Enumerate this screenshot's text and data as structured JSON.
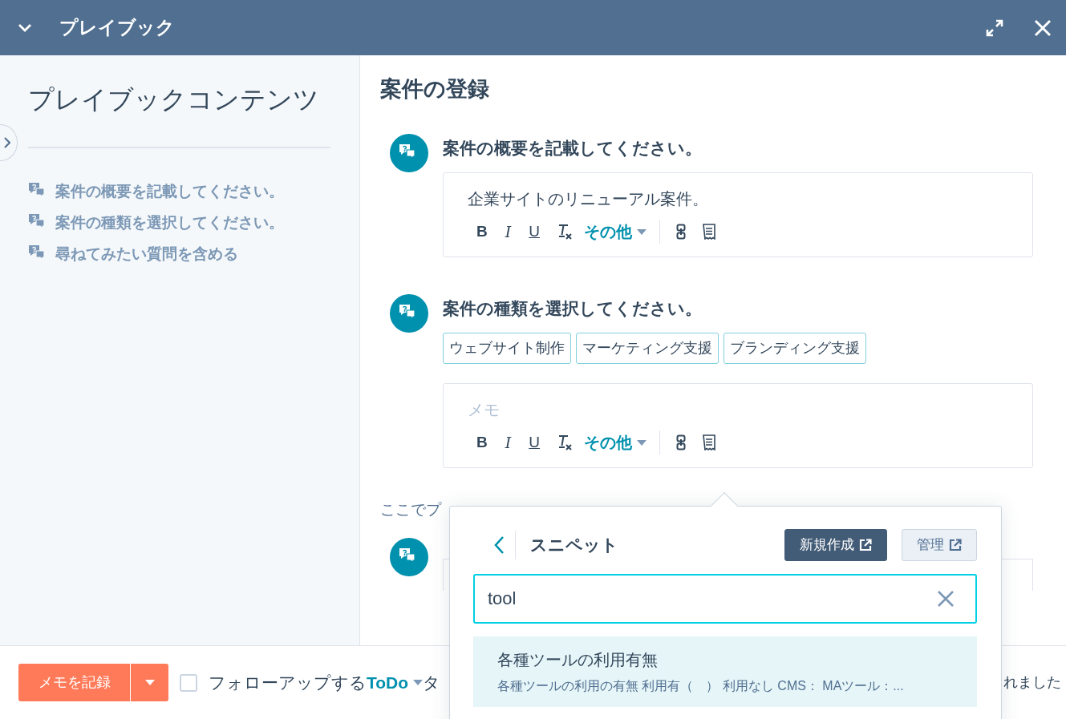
{
  "header": {
    "title": "プレイブック"
  },
  "sidebar": {
    "title": "プレイブックコンテンツ",
    "items": [
      {
        "label": "案件の概要を記載してください。"
      },
      {
        "label": "案件の種類を選択してください。"
      },
      {
        "label": "尋ねてみたい質問を含める"
      }
    ]
  },
  "main": {
    "title": "案件の登録",
    "questions": [
      {
        "kind": "text",
        "title": "案件の概要を記載してください。",
        "editor": {
          "value": "企業サイトのリニューアル案件。",
          "toolbar": {
            "bold": "B",
            "italic": "I",
            "underline": "U",
            "more": "その他"
          }
        }
      },
      {
        "kind": "choice",
        "title": "案件の種類を選択してください。",
        "options": [
          {
            "label": "ウェブサイト制作",
            "selected": false
          },
          {
            "label": "マーケティング支援",
            "selected": false
          },
          {
            "label": "ブランディング支援",
            "selected": false
          }
        ],
        "editor": {
          "placeholder": "メモ",
          "toolbar": {
            "bold": "B",
            "italic": "I",
            "underline": "U",
            "more": "その他"
          }
        }
      },
      {
        "kind": "covered"
      }
    ],
    "hint": "ここでプ"
  },
  "popover": {
    "title": "スニペット",
    "buttons": [
      {
        "label": "新規作成",
        "kind": "primary"
      },
      {
        "label": "管理",
        "kind": "secondary"
      }
    ],
    "search": {
      "value": "tool"
    },
    "results": [
      {
        "title": "各種ツールの利用有無",
        "preview": "各種ツールの利用の有無 利用有（　） 利用なし CMS： MAツール：...",
        "selected": true
      }
    ]
  },
  "footer": {
    "log_button": "メモを記録",
    "followup": {
      "checked": false,
      "label": "フォローアップする",
      "link": "ToDo",
      "tail": "タ"
    },
    "status": "れました"
  }
}
